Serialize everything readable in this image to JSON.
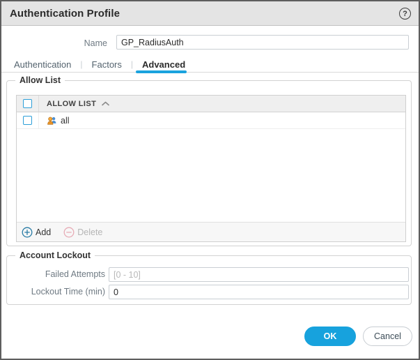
{
  "window": {
    "title": "Authentication Profile"
  },
  "form": {
    "name_label": "Name",
    "name_value": "GP_RadiusAuth"
  },
  "tabs": [
    {
      "label": "Authentication",
      "active": false
    },
    {
      "label": "Factors",
      "active": false
    },
    {
      "label": "Advanced",
      "active": true
    }
  ],
  "allow_list": {
    "legend": "Allow List",
    "column_header": "ALLOW LIST",
    "rows": [
      {
        "label": "all",
        "icon": "user-group-icon",
        "checked": false
      }
    ],
    "add_label": "Add",
    "delete_label": "Delete",
    "delete_disabled": true
  },
  "account_lockout": {
    "legend": "Account Lockout",
    "failed_attempts_label": "Failed Attempts",
    "failed_attempts_placeholder": "[0 - 10]",
    "failed_attempts_value": "",
    "lockout_time_label": "Lockout Time (min)",
    "lockout_time_value": "0"
  },
  "footer": {
    "ok_label": "OK",
    "cancel_label": "Cancel"
  },
  "colors": {
    "accent_blue": "#17a2dd",
    "checkbox_blue": "#2d9fd8",
    "titlebar_gray": "#e4e4e4"
  }
}
